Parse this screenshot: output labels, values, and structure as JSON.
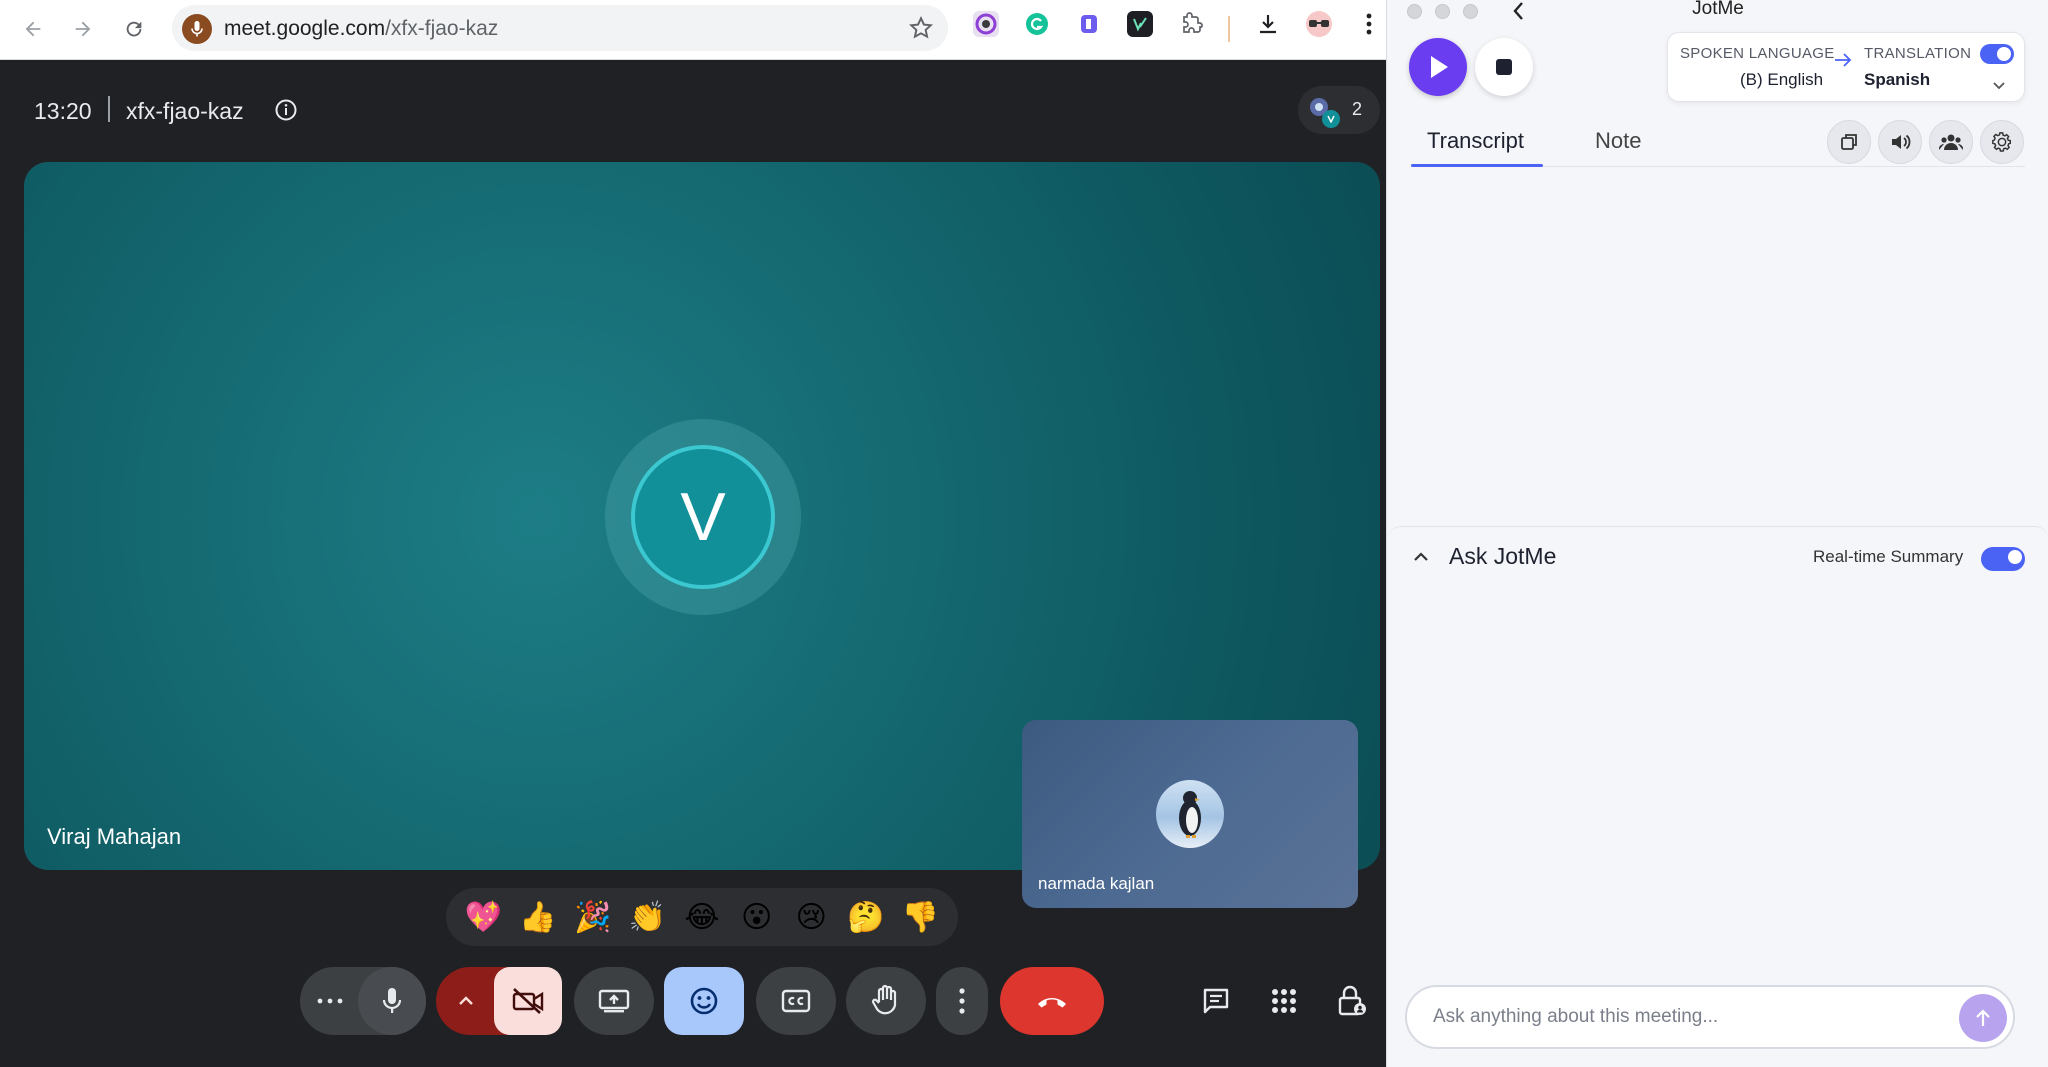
{
  "browser": {
    "url_host": "meet.google.com",
    "url_path": "/xfx-fjao-kaz",
    "icons": [
      "back-arrow-icon",
      "forward-arrow-icon",
      "reload-icon",
      "microphone-icon",
      "star-icon",
      "download-icon",
      "more-vert-icon"
    ]
  },
  "meet": {
    "time": "13:20",
    "meeting_code": "xfx-fjao-kaz",
    "participant_count": "2",
    "main_avatar_initial": "V",
    "main_name": "Viraj Mahajan",
    "pip_name": "narmada kajlan",
    "reactions": [
      "💖",
      "👍",
      "🎉",
      "👏",
      "😂",
      "😮",
      "😢",
      "🤔",
      "👎"
    ],
    "controls": [
      "more-options",
      "microphone",
      "camera-off",
      "present",
      "reactions",
      "captions",
      "raise-hand",
      "more",
      "leave-call"
    ],
    "accent": "#1a7a82"
  },
  "jotme": {
    "title": "JotMe",
    "spoken_language_label": "SPOKEN LANGUAGE",
    "spoken_language": "(B) English",
    "translation_label": "TRANSLATION",
    "translation_language": "Spanish",
    "tabs": [
      "Transcript",
      "Note"
    ],
    "ask_title": "Ask JotMe",
    "realtime_summary_label": "Real-time Summary",
    "ask_placeholder": "Ask anything about this meeting...",
    "accent": "#6b3df0"
  }
}
